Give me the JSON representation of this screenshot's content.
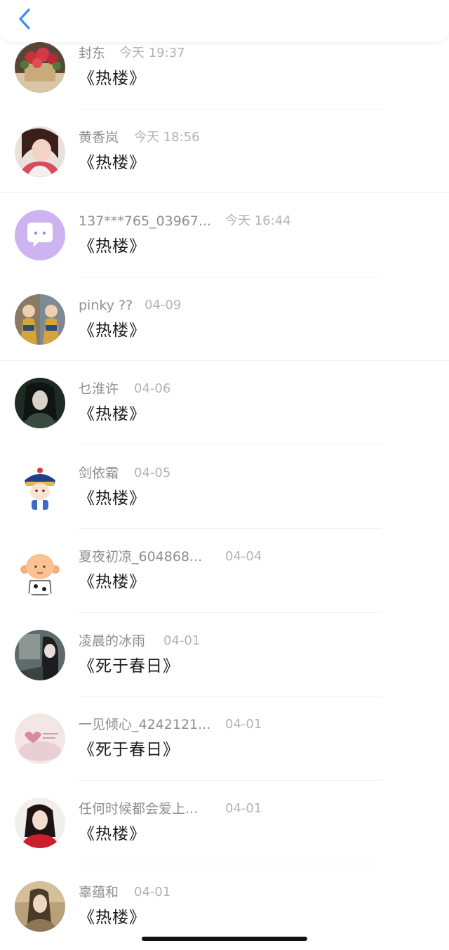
{
  "header": {
    "back_icon": "chevron-left-icon",
    "accent_color": "#3a8ef6"
  },
  "items": [
    {
      "name": "封东",
      "date": "今天 19:37",
      "title": "《热楼》",
      "avatar": "flowers"
    },
    {
      "name": "黄香岚",
      "date": "今天 18:56",
      "title": "《热楼》",
      "avatar": "girl-selfie"
    },
    {
      "name": "137***765_03967...",
      "date": "今天 16:44",
      "title": "《热楼》",
      "avatar": "default-chat-purple"
    },
    {
      "name": "pinky ??",
      "date": "04-09",
      "title": "《热楼》",
      "avatar": "mirrored-kids"
    },
    {
      "name": "乜淮许",
      "date": "04-06",
      "title": "《热楼》",
      "avatar": "woman-dark"
    },
    {
      "name": "剑依霜",
      "date": "04-05",
      "title": "《热楼》",
      "avatar": "cartoon-official"
    },
    {
      "name": "夏夜初凉_604868...",
      "date": "04-04",
      "title": "《热楼》",
      "avatar": "cartoon-baby"
    },
    {
      "name": "凌晨的冰雨",
      "date": "04-01",
      "title": "《死于春日》",
      "avatar": "woman-calligraphy"
    },
    {
      "name": "一见倾心_4242121...",
      "date": "04-01",
      "title": "《死于春日》",
      "avatar": "pink-love-text"
    },
    {
      "name": "任何时候都会爱上...",
      "date": "04-01",
      "title": "《热楼》",
      "avatar": "woman-red"
    },
    {
      "name": "辜蕴和",
      "date": "04-01",
      "title": "《热楼》",
      "avatar": "woman-sepia"
    }
  ]
}
